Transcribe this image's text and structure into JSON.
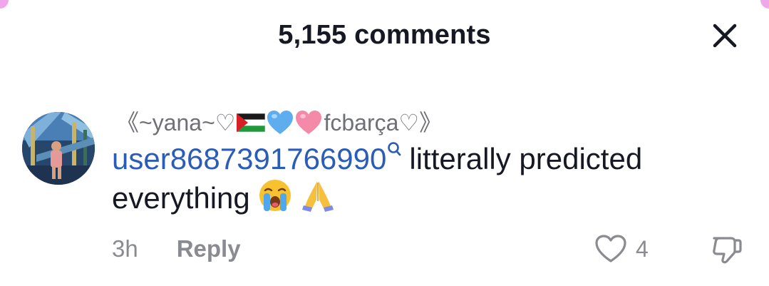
{
  "header": {
    "title": "5,155 comments"
  },
  "comment": {
    "display_name": {
      "prefix": "《~yana~♡",
      "suffix": "fcbarça♡》"
    },
    "mention": "user8687391766990",
    "text": "litterally predicted",
    "text_line2": "everything",
    "timestamp": "3h",
    "reply_label": "Reply",
    "like_count": "4"
  },
  "icons": {
    "close": "close-icon",
    "like": "heart-outline-icon",
    "dislike": "thumbs-down-icon",
    "search": "search-icon"
  },
  "colors": {
    "mention": "#2b5db8",
    "muted": "#8a8b91",
    "text": "#161823"
  }
}
